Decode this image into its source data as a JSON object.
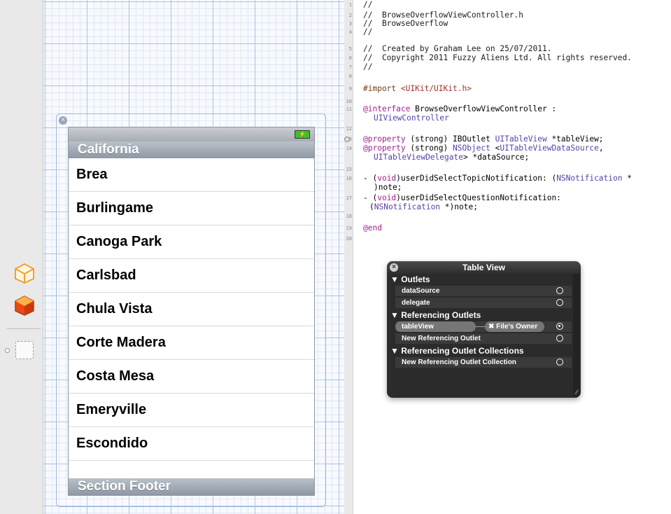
{
  "table": {
    "section_header": "California",
    "section_footer": "Section Footer",
    "rows": [
      "Brea",
      "Burlingame",
      "Canoga Park",
      "Carlsbad",
      "Chula Vista",
      "Corte Madera",
      "Costa Mesa",
      "Emeryville",
      "Escondido"
    ]
  },
  "editor": {
    "line_numbers": [
      "1",
      "2",
      "3",
      "4",
      "5",
      "6",
      "7",
      "8",
      "9",
      "10",
      "11",
      "",
      "12",
      "13",
      "14",
      "",
      "15",
      "16",
      "",
      "17",
      "",
      "18",
      "19",
      "20"
    ],
    "lines": {
      "l1": "//",
      "l2": "//  BrowseOverflowViewController.h",
      "l3": "//  BrowseOverflow",
      "l4": "//",
      "l5": "//  Created by Graham Lee on 25/07/2011.",
      "l6": "//  Copyright 2011 Fuzzy Aliens Ltd. All rights reserved.",
      "l7": "//",
      "l9_a": "#import ",
      "l9_b": "<UIKit/UIKit.h>",
      "l11_a": "@interface",
      "l11_b": " BrowseOverflowViewController :",
      "l11_c": "UIViewController",
      "l13_a": "@property",
      "l13_b": " (strong) IBOutlet ",
      "l13_c": "UITableView",
      "l13_d": " *tableView;",
      "l14_a": "@property",
      "l14_b": " (strong) ",
      "l14_c": "NSObject",
      "l14_d": " <",
      "l14_e": "UITableViewDataSource",
      "l14_f": ",",
      "l14_g": "UITableViewDelegate",
      "l14_h": "> *dataSource;",
      "l16_a": "- (",
      "l16_b": "void",
      "l16_c": ")userDidSelectTopicNotification: (",
      "l16_d": "NSNotification",
      "l16_e": " *",
      "l16_f": ")note;",
      "l17_a": "- (",
      "l17_b": "void",
      "l17_c": ")userDidSelectQuestionNotification:",
      "l17_d": "NSNotification",
      "l17_e": " *)note;",
      "l19": "@end"
    }
  },
  "connections": {
    "title": "Table View",
    "sections": {
      "outlets": "Outlets",
      "referencing_outlets": "Referencing Outlets",
      "referencing_collections": "Referencing Outlet Collections"
    },
    "outlets": [
      "dataSource",
      "delegate"
    ],
    "referencing_outlet": "tableView",
    "connected_object": "File's Owner",
    "new_referencing_outlet": "New Referencing Outlet",
    "new_referencing_collection": "New Referencing Outlet Collection"
  },
  "icons": {
    "dock_object_1": "cube-outline-icon",
    "dock_object_2": "cube-filled-icon",
    "battery": "battery-icon"
  }
}
